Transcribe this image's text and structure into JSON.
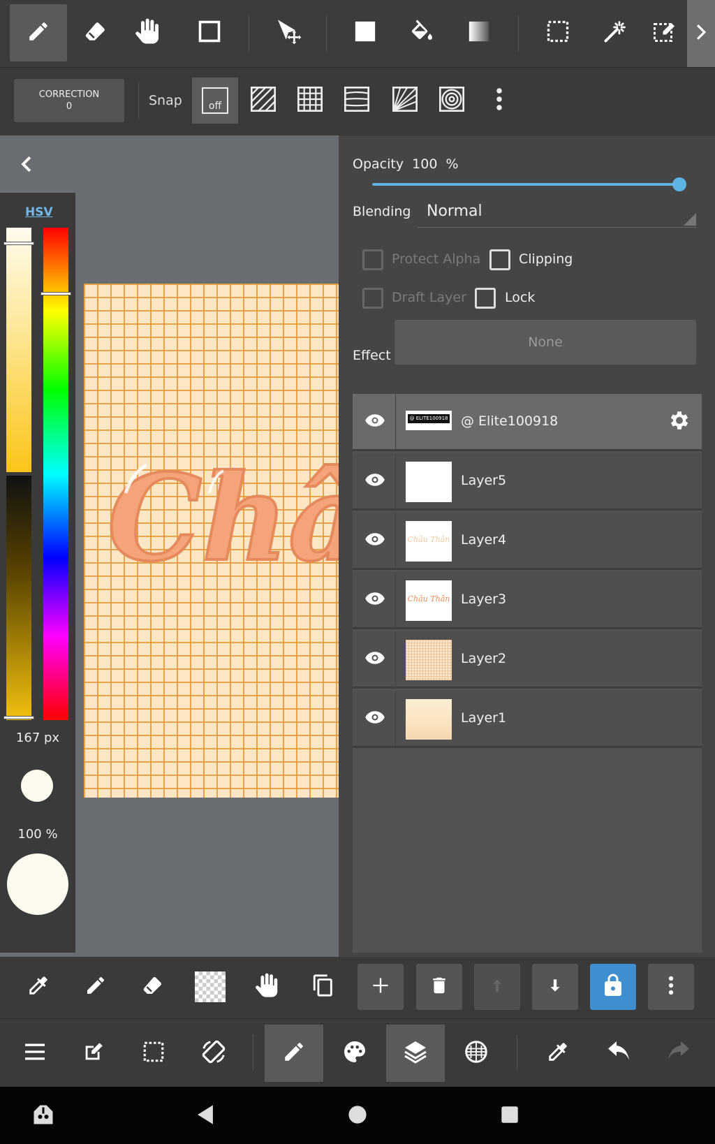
{
  "colors": {
    "accent": "#3f8fd0",
    "slider": "#5fb2e4",
    "paper": "#fde6c4",
    "grid": "#e49632",
    "lettering": "#f7a87a"
  },
  "top_toolbar": {
    "tools": [
      "pen-icon",
      "eraser-icon",
      "hand-icon",
      "rectangle-icon",
      "move-icon",
      "fill-rect-icon",
      "bucket-icon",
      "gradient-icon",
      "select-rect-icon",
      "magic-wand-icon",
      "select-pen-icon"
    ],
    "active": "pen-icon"
  },
  "brush_bar": {
    "correction_label": "CORRECTION",
    "correction_value": "0",
    "snap_label": "Snap",
    "snap_off_label": "off"
  },
  "color_panel": {
    "mode_label": "HSV",
    "brush_size": "167 px",
    "brush_opacity": "100 %"
  },
  "layer_props": {
    "opacity_label": "Opacity",
    "opacity_value": "100",
    "opacity_unit": "%",
    "opacity_fraction": 1.0,
    "blending_label": "Blending",
    "blending_value": "Normal",
    "protect_alpha_label": "Protect Alpha",
    "clipping_label": "Clipping",
    "draft_layer_label": "Draft Layer",
    "lock_label": "Lock",
    "effect_label": "Effect",
    "effect_value": "None"
  },
  "layers": [
    {
      "name": "@ Elite100918",
      "selected": true,
      "thumb": "watermark",
      "thumb_text": "@ ELITE100918"
    },
    {
      "name": "Layer5",
      "selected": false,
      "thumb": "blank"
    },
    {
      "name": "Layer4",
      "selected": false,
      "thumb": "lettering-light",
      "thumb_text": "Châu Thân"
    },
    {
      "name": "Layer3",
      "selected": false,
      "thumb": "lettering",
      "thumb_text": "Châu Thân"
    },
    {
      "name": "Layer2",
      "selected": false,
      "thumb": "grid"
    },
    {
      "name": "Layer1",
      "selected": false,
      "thumb": "cream"
    }
  ],
  "canvas": {
    "lettering_text": "Châ"
  }
}
